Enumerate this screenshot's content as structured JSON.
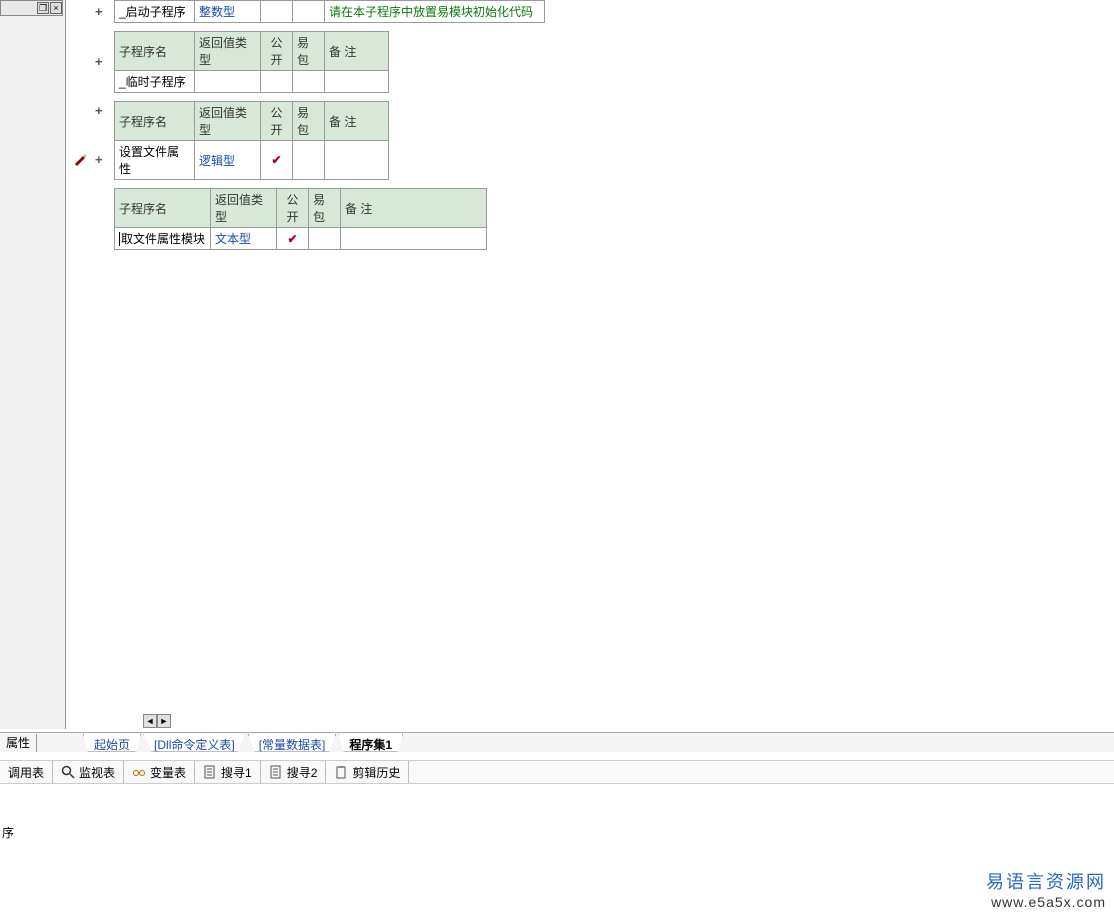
{
  "sidebar": {
    "btn_restore": "❐",
    "btn_close": "×"
  },
  "tables": [
    {
      "headers": null,
      "row": {
        "name": "_启动子程序",
        "type": "整数型",
        "pub": "",
        "pkg": "",
        "note": "请在本子程序中放置易模块初始化代码"
      },
      "widenote": true,
      "check": false
    },
    {
      "headers": {
        "c1": "子程序名",
        "c2": "返回值类型",
        "c3": "公开",
        "c4": "易包",
        "c5": "备  注"
      },
      "row": {
        "name": "_临时子程序",
        "type": "",
        "pub": "",
        "pkg": "",
        "note": ""
      },
      "widenote": false,
      "check": false
    },
    {
      "headers": {
        "c1": "子程序名",
        "c2": "返回值类型",
        "c3": "公开",
        "c4": "易包",
        "c5": "备  注"
      },
      "row": {
        "name": "设置文件属性",
        "type": "逻辑型",
        "pub": "✔",
        "pkg": "",
        "note": ""
      },
      "widenote": false,
      "check": true
    },
    {
      "headers": {
        "c1": "子程序名",
        "c2": "返回值类型",
        "c3": "公开",
        "c4": "易包",
        "c5": "备  注"
      },
      "row": {
        "name": "取文件属性模块",
        "type": "文本型",
        "pub": "✔",
        "pkg": "",
        "note": ""
      },
      "widenote": false,
      "check": true,
      "editing": true,
      "namewide": true
    }
  ],
  "gutter_plus": "+",
  "bottom_tabs": {
    "props": "属性",
    "files": [
      {
        "label": "起始页",
        "active": false
      },
      {
        "label": "[Dll命令定义表]",
        "active": false
      },
      {
        "label": "[常量数据表]",
        "active": false
      },
      {
        "label": "程序集1",
        "active": true
      }
    ]
  },
  "tool_tabs": [
    {
      "label": "调用表",
      "icon": "list"
    },
    {
      "label": "监视表",
      "icon": "magnify"
    },
    {
      "label": "变量表",
      "icon": "glasses"
    },
    {
      "label": "搜寻1",
      "icon": "doc"
    },
    {
      "label": "搜寻2",
      "icon": "doc"
    },
    {
      "label": "剪辑历史",
      "icon": "clip"
    }
  ],
  "status": "序",
  "watermark": {
    "title": "易语言资源网",
    "url": "www.e5a5x.com"
  }
}
